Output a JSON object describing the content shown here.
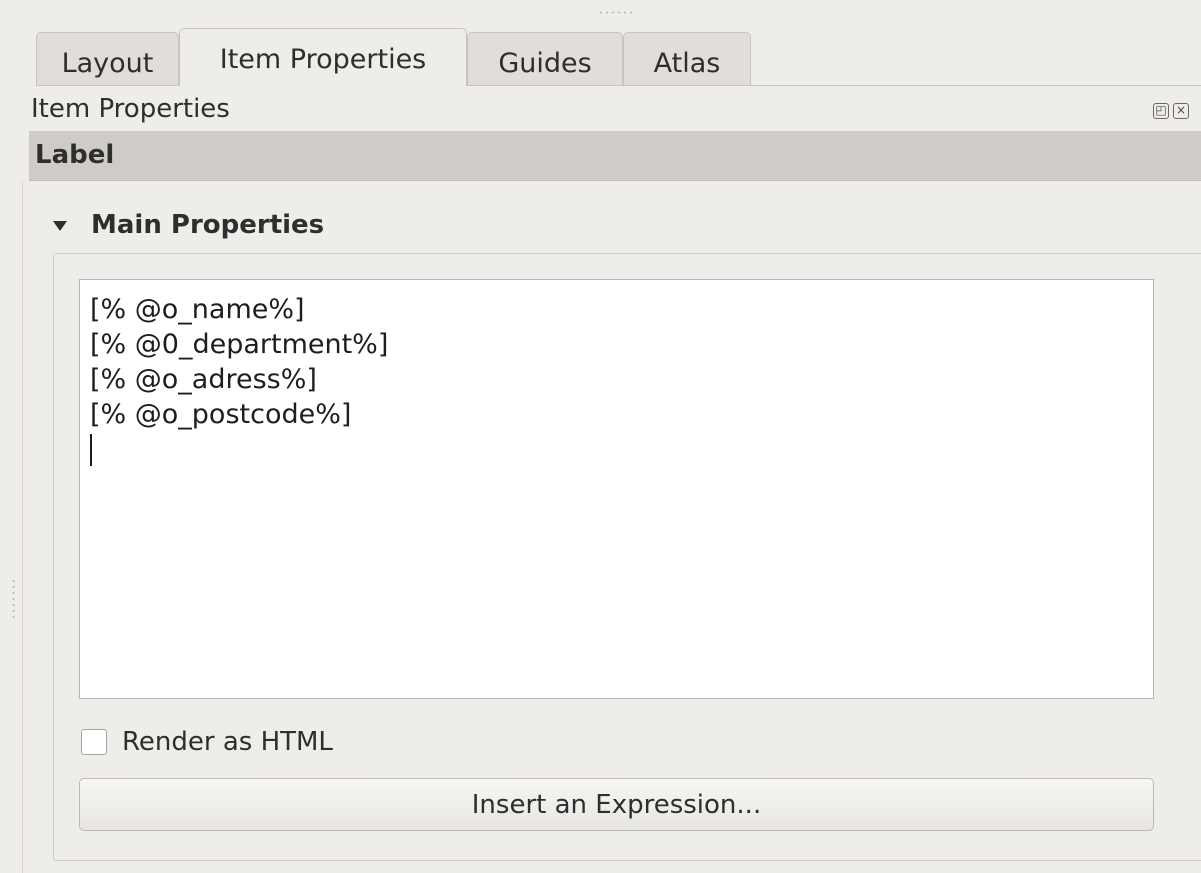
{
  "tabs": [
    {
      "label": "Layout",
      "active": false
    },
    {
      "label": "Item Properties",
      "active": true
    },
    {
      "label": "Guides",
      "active": false
    },
    {
      "label": "Atlas",
      "active": false
    }
  ],
  "panel": {
    "title": "Item Properties",
    "float_icon": "float-icon",
    "close_icon": "close-icon"
  },
  "item_type": "Label",
  "main_properties": {
    "title": "Main Properties",
    "expanded": true,
    "text_lines": [
      "[% @o_name%]",
      "[% @0_department%]",
      "[% @o_adress%]",
      "[% @o_postcode%]"
    ],
    "render_as_html": {
      "label": "Render as HTML",
      "checked": false
    },
    "insert_expression_label": "Insert an Expression..."
  },
  "colors": {
    "background": "#efedea",
    "header_bar": "#cfccc7",
    "editor_bg": "#ffffff"
  }
}
